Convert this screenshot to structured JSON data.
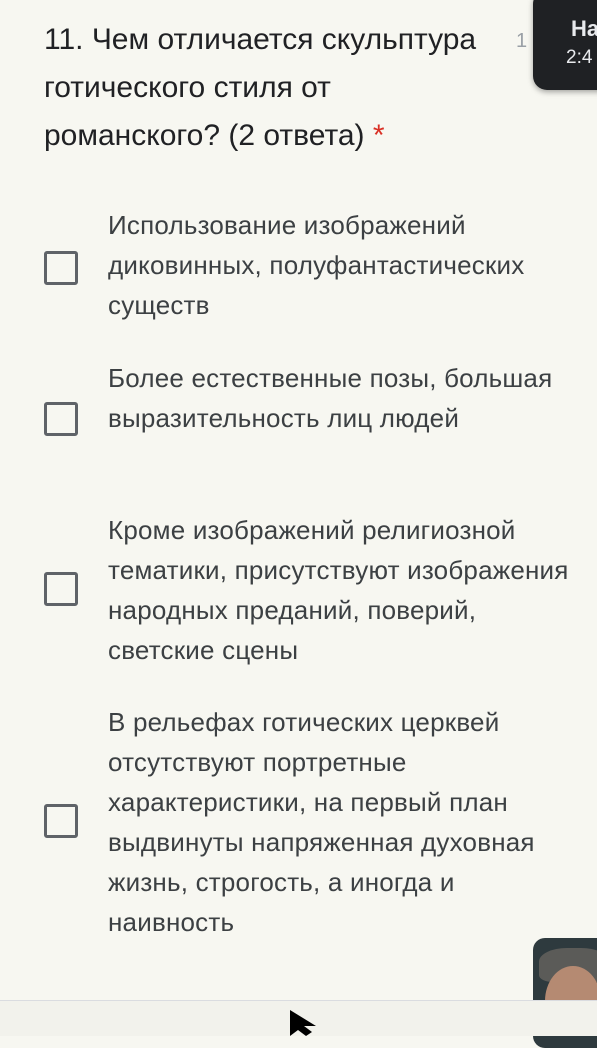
{
  "question": {
    "text": "11. Чем отличается скульптура готического стиля от романского? (2 ответа)",
    "required_mark": "*",
    "points": "1"
  },
  "options": [
    {
      "label": "Использование изображений диковинных, полуфантастических существ",
      "checked": false
    },
    {
      "label": "Более естественные позы, большая выразительность лиц людей",
      "checked": false
    },
    {
      "label": "Кроме изображений религиозной тематики, присутствуют изображения народных преданий, поверий, светские сцены",
      "checked": false
    },
    {
      "label": "В рельефах готических церквей отсутствуют портретные характеристики, на первый план выдвинуты напряженная духовная жизнь, строгость, а иногда и наивность",
      "checked": false
    }
  ],
  "notification": {
    "title": "На",
    "time": "2:4"
  },
  "colors": {
    "background": "#f7f7f1",
    "required": "#d93025",
    "checkbox_border": "#5f6368"
  }
}
